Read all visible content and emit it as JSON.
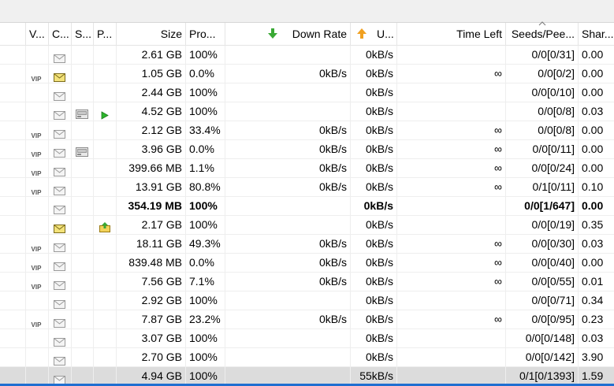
{
  "columns": {
    "v": "V...",
    "c": "C...",
    "s": "S...",
    "p": "P...",
    "size": "Size",
    "progress": "Pro...",
    "down_rate": "Down Rate",
    "up_rate": "U...",
    "time_left": "Time Left",
    "seeds_peers": "Seeds/Pee...",
    "share": "Shar..."
  },
  "icons": {
    "down_rate_header": "green-down-arrow-icon",
    "up_rate_header": "orange-up-arrow-icon",
    "v_column": "vip-icon",
    "c_column": "envelope-icon",
    "s_column": "hard-drive-icon",
    "p_column": "play-icon / upload-folder-icon"
  },
  "colors": {
    "selected_row": "#dcdcdc",
    "down_arrow": "#3aa935",
    "up_arrow": "#f0a020"
  },
  "rows": [
    {
      "vip": false,
      "mail": "grey",
      "s": false,
      "p": "",
      "size": "2.61 GB",
      "progress": "100%",
      "down": "",
      "up": "0kB/s",
      "time": "",
      "seeds": "0/0[0/31]",
      "share": "0.00"
    },
    {
      "vip": true,
      "mail": "yellow",
      "s": false,
      "p": "",
      "size": "1.05 GB",
      "progress": "0.0%",
      "down": "0kB/s",
      "up": "0kB/s",
      "time": "∞",
      "seeds": "0/0[0/2]",
      "share": "0.00"
    },
    {
      "vip": false,
      "mail": "grey",
      "s": false,
      "p": "",
      "size": "2.44 GB",
      "progress": "100%",
      "down": "",
      "up": "0kB/s",
      "time": "",
      "seeds": "0/0[0/10]",
      "share": "0.00"
    },
    {
      "vip": false,
      "mail": "grey",
      "s": true,
      "p": "play",
      "size": "4.52 GB",
      "progress": "100%",
      "down": "",
      "up": "0kB/s",
      "time": "",
      "seeds": "0/0[0/8]",
      "share": "0.03"
    },
    {
      "vip": true,
      "mail": "grey",
      "s": false,
      "p": "",
      "size": "2.12 GB",
      "progress": "33.4%",
      "down": "0kB/s",
      "up": "0kB/s",
      "time": "∞",
      "seeds": "0/0[0/8]",
      "share": "0.00"
    },
    {
      "vip": true,
      "mail": "grey",
      "s": true,
      "p": "",
      "size": "3.96 GB",
      "progress": "0.0%",
      "down": "0kB/s",
      "up": "0kB/s",
      "time": "∞",
      "seeds": "0/0[0/11]",
      "share": "0.00"
    },
    {
      "vip": true,
      "mail": "grey",
      "s": false,
      "p": "",
      "size": "399.66 MB",
      "progress": "1.1%",
      "down": "0kB/s",
      "up": "0kB/s",
      "time": "∞",
      "seeds": "0/0[0/24]",
      "share": "0.00"
    },
    {
      "vip": true,
      "mail": "grey",
      "s": false,
      "p": "",
      "size": "13.91 GB",
      "progress": "80.8%",
      "down": "0kB/s",
      "up": "0kB/s",
      "time": "∞",
      "seeds": "0/1[0/11]",
      "share": "0.10"
    },
    {
      "vip": false,
      "mail": "grey",
      "s": false,
      "p": "",
      "size": "354.19 MB",
      "progress": "100%",
      "down": "",
      "up": "0kB/s",
      "time": "",
      "seeds": "0/0[1/647]",
      "share": "0.00",
      "bold": true
    },
    {
      "vip": false,
      "mail": "yellow",
      "s": false,
      "p": "upload",
      "size": "2.17 GB",
      "progress": "100%",
      "down": "",
      "up": "0kB/s",
      "time": "",
      "seeds": "0/0[0/19]",
      "share": "0.35"
    },
    {
      "vip": true,
      "mail": "grey",
      "s": false,
      "p": "",
      "size": "18.11 GB",
      "progress": "49.3%",
      "down": "0kB/s",
      "up": "0kB/s",
      "time": "∞",
      "seeds": "0/0[0/30]",
      "share": "0.03"
    },
    {
      "vip": true,
      "mail": "grey",
      "s": false,
      "p": "",
      "size": "839.48 MB",
      "progress": "0.0%",
      "down": "0kB/s",
      "up": "0kB/s",
      "time": "∞",
      "seeds": "0/0[0/40]",
      "share": "0.00"
    },
    {
      "vip": true,
      "mail": "grey",
      "s": false,
      "p": "",
      "size": "7.56 GB",
      "progress": "7.1%",
      "down": "0kB/s",
      "up": "0kB/s",
      "time": "∞",
      "seeds": "0/0[0/55]",
      "share": "0.01"
    },
    {
      "vip": false,
      "mail": "grey",
      "s": false,
      "p": "",
      "size": "2.92 GB",
      "progress": "100%",
      "down": "",
      "up": "0kB/s",
      "time": "",
      "seeds": "0/0[0/71]",
      "share": "0.34"
    },
    {
      "vip": true,
      "mail": "grey",
      "s": false,
      "p": "",
      "size": "7.87 GB",
      "progress": "23.2%",
      "down": "0kB/s",
      "up": "0kB/s",
      "time": "∞",
      "seeds": "0/0[0/95]",
      "share": "0.23"
    },
    {
      "vip": false,
      "mail": "grey",
      "s": false,
      "p": "",
      "size": "3.07 GB",
      "progress": "100%",
      "down": "",
      "up": "0kB/s",
      "time": "",
      "seeds": "0/0[0/148]",
      "share": "0.03"
    },
    {
      "vip": false,
      "mail": "grey",
      "s": false,
      "p": "",
      "size": "2.70 GB",
      "progress": "100%",
      "down": "",
      "up": "0kB/s",
      "time": "",
      "seeds": "0/0[0/142]",
      "share": "3.90"
    },
    {
      "vip": false,
      "mail": "grey",
      "s": false,
      "p": "",
      "size": "4.94 GB",
      "progress": "100%",
      "down": "",
      "up": "55kB/s",
      "time": "",
      "seeds": "0/1[0/1393]",
      "share": "1.59",
      "selected": true
    }
  ]
}
